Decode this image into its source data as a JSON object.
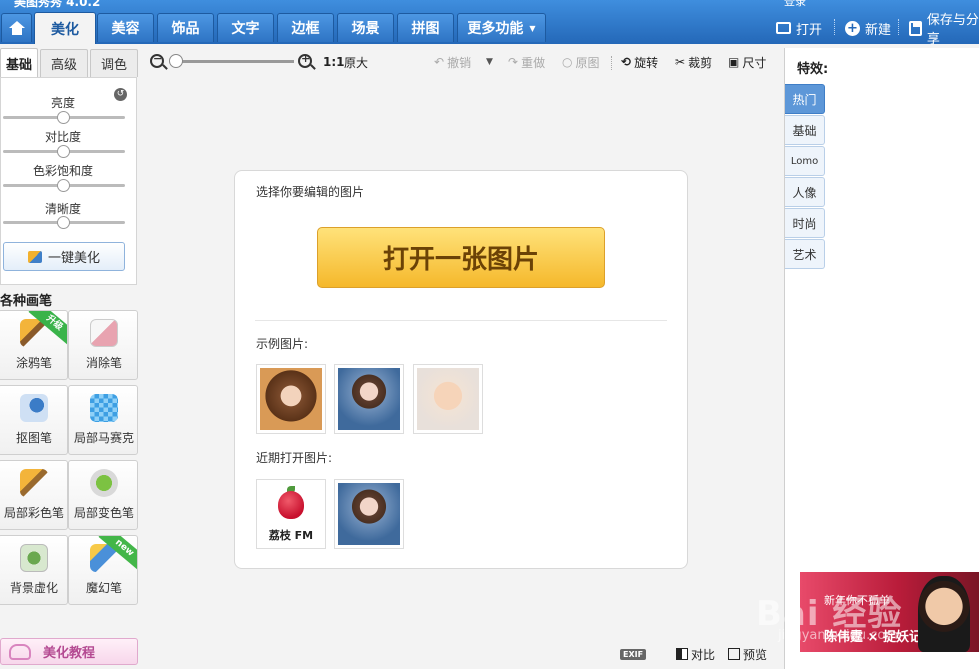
{
  "window": {
    "title": "美图秀秀 4.0.2",
    "login": "登录"
  },
  "main_tabs": [
    {
      "label": "美化",
      "active": true
    },
    {
      "label": "美容"
    },
    {
      "label": "饰品"
    },
    {
      "label": "文字"
    },
    {
      "label": "边框"
    },
    {
      "label": "场景"
    },
    {
      "label": "拼图"
    },
    {
      "label": "更多功能"
    }
  ],
  "top_right": {
    "open": "打开",
    "new": "新建",
    "save_share": "保存与分享"
  },
  "left": {
    "subtabs": [
      "基础",
      "高级",
      "调色"
    ],
    "adjustments": [
      {
        "label": "亮度",
        "value": 0.5
      },
      {
        "label": "对比度",
        "value": 0.5
      },
      {
        "label": "色彩饱和度",
        "value": 0.5
      },
      {
        "label": "清晰度",
        "value": 0.5
      }
    ],
    "one_key_beautify": "一键美化",
    "brushes_title": "各种画笔",
    "tools": [
      {
        "label": "涂鸦笔",
        "badge": "升级"
      },
      {
        "label": "消除笔"
      },
      {
        "label": "抠图笔"
      },
      {
        "label": "局部马赛克"
      },
      {
        "label": "局部彩色笔"
      },
      {
        "label": "局部变色笔"
      },
      {
        "label": "背景虚化"
      },
      {
        "label": "魔幻笔",
        "badge": "new"
      }
    ],
    "tutorial": "美化教程"
  },
  "toolbar": {
    "zoom_ratio": "1:1",
    "original_size": "原大",
    "undo": "撤销",
    "redo": "重做",
    "original": "原图",
    "rotate": "旋转",
    "crop": "裁剪",
    "size": "尺寸"
  },
  "card": {
    "prompt": "选择你要编辑的图片",
    "open_button": "打开一张图片",
    "samples_label": "示例图片:",
    "recent_label": "近期打开图片:",
    "recent_lizhi_text": "荔枝 FM"
  },
  "effects": {
    "title": "特效:",
    "tabs": [
      "热门",
      "基础",
      "Lomo",
      "人像",
      "时尚",
      "艺术"
    ]
  },
  "ad": {
    "line1": "新年你不孤单",
    "line2": "陈伟霆 × 捉妖记"
  },
  "bottom": {
    "exif": "EXIF",
    "compare": "对比",
    "preview": "预览"
  },
  "watermark": {
    "text": "Bai 经验",
    "sub": "jingyan.baidu.com"
  },
  "colors": {
    "accent_blue": "#2468b8",
    "open_button_yellow": "#f5b82b",
    "active_fx_tab": "#5d97d8"
  }
}
